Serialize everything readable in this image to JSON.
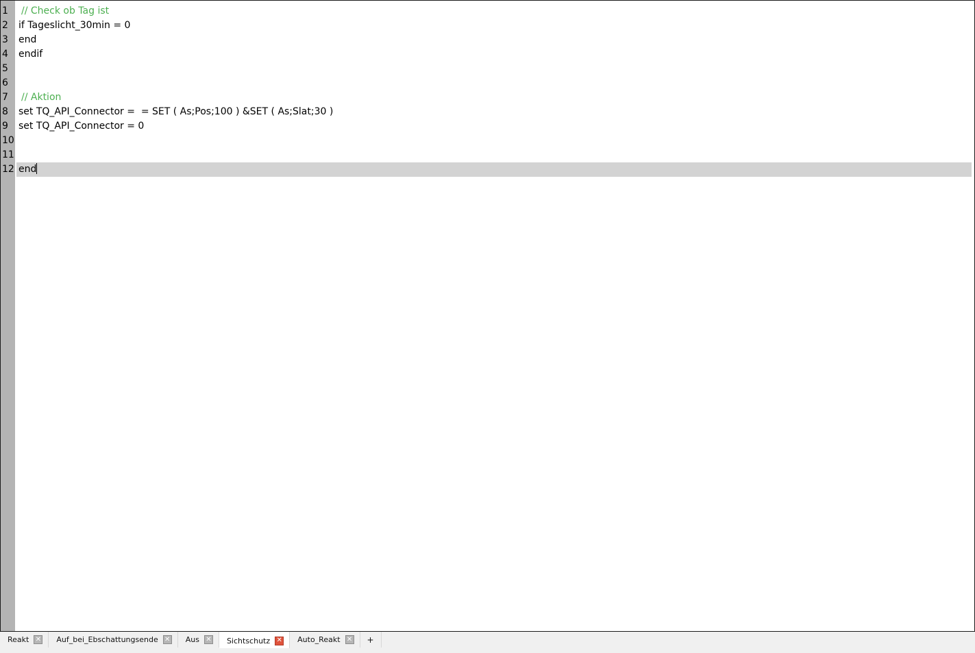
{
  "editor": {
    "lines": [
      {
        "number": "1",
        "text": "// Check ob Tag ist",
        "kind": "comment"
      },
      {
        "number": "2",
        "text": "if Tageslicht_30min = 0",
        "kind": "code"
      },
      {
        "number": "3",
        "text": "end",
        "kind": "code"
      },
      {
        "number": "4",
        "text": "endif",
        "kind": "code"
      },
      {
        "number": "5",
        "text": "",
        "kind": "code"
      },
      {
        "number": "6",
        "text": "",
        "kind": "code"
      },
      {
        "number": "7",
        "text": "// Aktion",
        "kind": "comment"
      },
      {
        "number": "8",
        "text": "set TQ_API_Connector =  = SET ( As;Pos;100 ) &SET ( As;Slat;30 )",
        "kind": "code"
      },
      {
        "number": "9",
        "text": "set TQ_API_Connector = 0",
        "kind": "code"
      },
      {
        "number": "10",
        "text": "",
        "kind": "code"
      },
      {
        "number": "11",
        "text": "",
        "kind": "code"
      },
      {
        "number": "12",
        "text": "end",
        "kind": "code",
        "current": true
      }
    ],
    "colors": {
      "comment": "#4caf50",
      "gutter": "#b4b4b4",
      "current_line": "#d3d3d3"
    }
  },
  "tabs": [
    {
      "label": "Reakt",
      "active": false
    },
    {
      "label": "Auf_bei_Ebschattungsende",
      "active": false
    },
    {
      "label": "Aus",
      "active": false
    },
    {
      "label": "Sichtschutz",
      "active": true
    },
    {
      "label": "Auto_Reakt",
      "active": false
    }
  ],
  "tab_add_label": "+",
  "tab_close_icon": "close-icon",
  "tab_close_glyph": "✕",
  "active_close_color": "#e0533c"
}
